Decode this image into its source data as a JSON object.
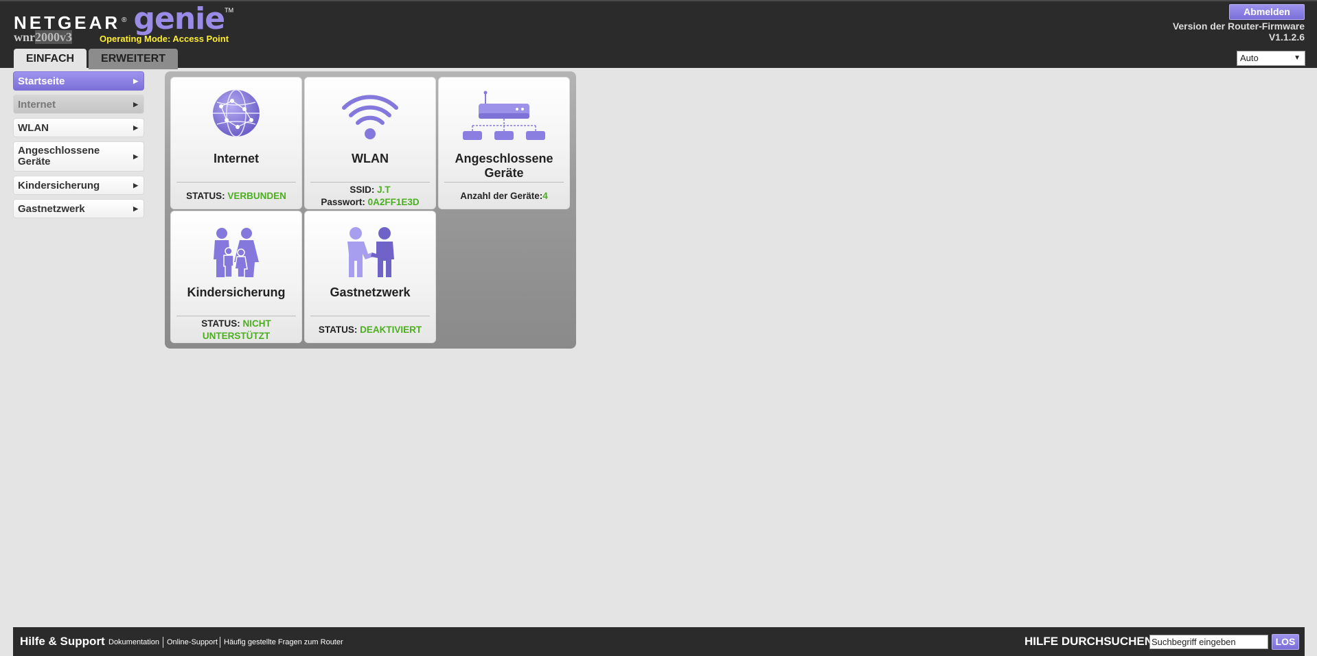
{
  "header": {
    "brand": "NETGEAR",
    "brand_reg": "®",
    "product": "genie",
    "product_tm": "TM",
    "model_prefix": "wnr",
    "model_suffix": "2000v3",
    "operating_mode": "Operating Mode: Access Point",
    "logout_label": "Abmelden",
    "firmware_label": "Version der Router-Firmware",
    "firmware_version": "V1.1.2.6",
    "tabs": [
      {
        "label": "EINFACH",
        "active": true
      },
      {
        "label": "ERWEITERT",
        "active": false
      }
    ],
    "language_select": {
      "value": "Auto"
    }
  },
  "sidebar": {
    "items": [
      {
        "label": "Startseite",
        "state": "active"
      },
      {
        "label": "Internet",
        "state": "disabled"
      },
      {
        "label": "WLAN",
        "state": "normal"
      },
      {
        "label": "Angeschlossene Geräte",
        "state": "normal"
      },
      {
        "label": "Kindersicherung",
        "state": "normal"
      },
      {
        "label": "Gastnetzwerk",
        "state": "normal"
      }
    ]
  },
  "dashboard": {
    "internet": {
      "title": "Internet",
      "icon": "globe-icon",
      "status_label": "STATUS:",
      "status_value": "VERBUNDEN"
    },
    "wlan": {
      "title": "WLAN",
      "icon": "wifi-icon",
      "ssid_label": "SSID:",
      "ssid_value": "J.T",
      "password_label": "Passwort:",
      "password_value": "0A2FF1E3D"
    },
    "devices": {
      "title_line1": "Angeschlossene",
      "title_line2": "Geräte",
      "icon": "network-devices-icon",
      "count_label": "Anzahl der Geräte:",
      "count_value": "4"
    },
    "parental": {
      "title": "Kindersicherung",
      "icon": "family-icon",
      "status_label": "STATUS:",
      "status_value_line1": "NICHT",
      "status_value_line2": "UNTERSTÜTZT"
    },
    "guest": {
      "title": "Gastnetzwerk",
      "icon": "handshake-icon",
      "status_label": "STATUS:",
      "status_value": "DEAKTIVIERT"
    }
  },
  "footer": {
    "title": "Hilfe & Support",
    "links": [
      "Dokumentation",
      "Online-Support",
      "Häufig gestellte Fragen zum Router"
    ],
    "search_label": "HILFE DURCHSUCHEN",
    "search_value": "Suchbegriff eingeben",
    "search_button": "LOS"
  },
  "colors": {
    "accent": "#8a7ee0",
    "header_bg": "#2b2b2b",
    "status_green": "#4aae1e",
    "opmode_yellow": "#ffee33"
  }
}
